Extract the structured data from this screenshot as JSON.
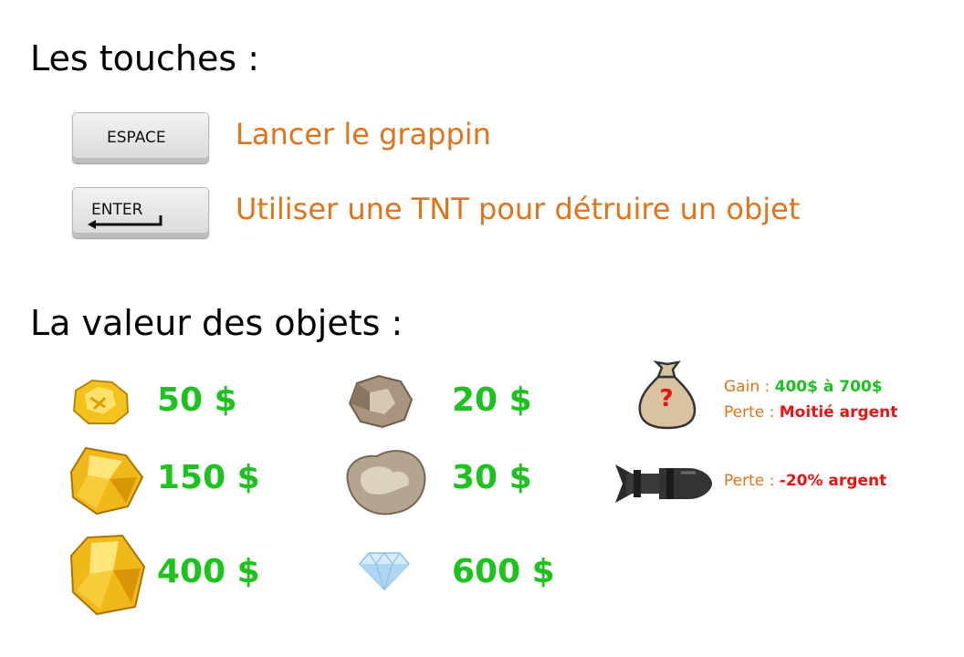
{
  "controls": {
    "title": "Les touches :",
    "keys": [
      {
        "key_label": "ESPACE",
        "description": "Lancer le grappin"
      },
      {
        "key_label": "ENTER",
        "description": "Utiliser une TNT pour détruire un objet"
      }
    ]
  },
  "values": {
    "title": "La valeur des objets :",
    "gold": [
      {
        "icon": "gold-nugget-small-icon",
        "price": "50 $"
      },
      {
        "icon": "gold-nugget-medium-icon",
        "price": "150 $"
      },
      {
        "icon": "gold-nugget-large-icon",
        "price": "400 $"
      }
    ],
    "others": [
      {
        "icon": "small-rock-icon",
        "price": "20 $"
      },
      {
        "icon": "large-rock-icon",
        "price": "30 $"
      },
      {
        "icon": "diamond-icon",
        "price": "600 $"
      }
    ],
    "mystery_bag": {
      "icon": "mystery-bag-icon",
      "bag_mark": "?",
      "gain_label": "Gain : ",
      "gain_value": "400$ à 700$",
      "loss_label": "Perte : ",
      "loss_value": "Moitié argent"
    },
    "bomb": {
      "icon": "bomb-icon",
      "loss_label": "Perte : ",
      "loss_value": "-20% argent"
    }
  },
  "colors": {
    "description": "#e0731b",
    "price": "#1ec21e",
    "penalty": "#ee1111"
  }
}
